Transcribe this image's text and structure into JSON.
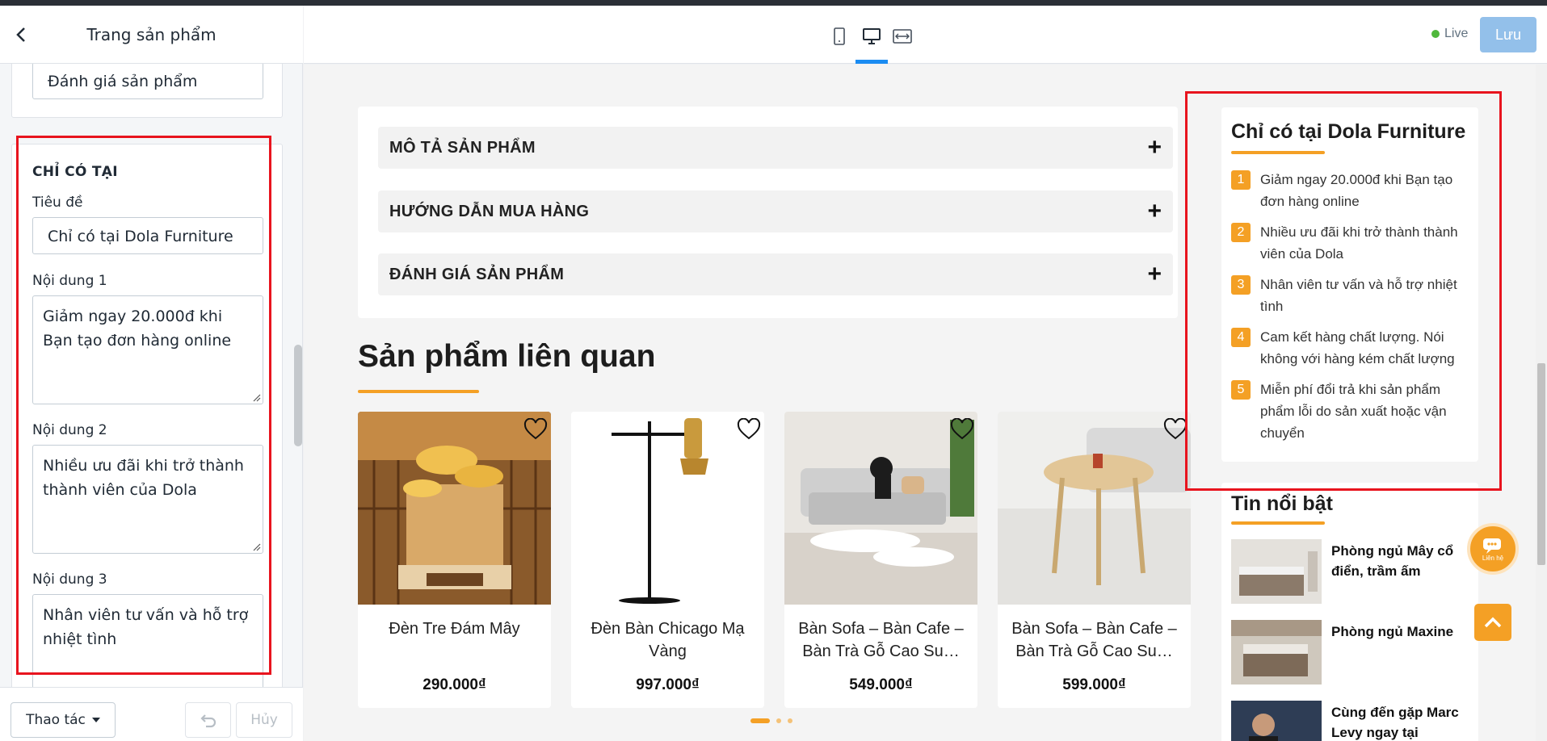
{
  "sidebar": {
    "title": "Trang sản phẩm",
    "review_field_value": "Đánh giá sản phẩm",
    "section_title": "CHỈ CÓ TẠI",
    "label_title": "Tiêu đề",
    "title_value": "Chỉ có tại Dola Furniture",
    "label_content1": "Nội dung 1",
    "content1_value": "Giảm ngay 20.000đ khi Bạn tạo đơn hàng online",
    "label_content2": "Nội dung 2",
    "content2_value": "Nhiều ưu đãi khi trở thành thành viên của Dola",
    "label_content3": "Nội dung 3",
    "content3_value": "Nhân viên tư vấn và hỗ trợ nhiệt tình",
    "footer": {
      "actions_label": "Thao tác",
      "cancel_label": "Hủy"
    }
  },
  "topbar": {
    "live_label": "Live",
    "save_label": "Lưu",
    "colors": {
      "accent": "#1b8cf2",
      "save_bg": "#93c0ea",
      "live_dot": "#50b83c"
    }
  },
  "preview": {
    "accordion": [
      {
        "label": "MÔ TẢ SẢN PHẨM"
      },
      {
        "label": "HƯỚNG DẪN MUA HÀNG"
      },
      {
        "label": "ĐÁNH GIÁ SẢN PHẨM"
      }
    ],
    "related_title": "Sản phẩm liên quan",
    "products": [
      {
        "name": "Đèn Tre Đám Mây",
        "price": "290.000₫"
      },
      {
        "name": "Đèn Bàn Chicago Mạ Vàng",
        "price": "997.000₫"
      },
      {
        "name": "Bàn Sofa – Bàn Cafe – Bàn Trà Gỗ Cao Su…",
        "price": "549.000₫"
      },
      {
        "name": "Bàn Sofa – Bàn Cafe – Bàn Trà Gỗ Cao Su…",
        "price": "599.000₫"
      }
    ],
    "only_at": {
      "title": "Chỉ có tại Dola Furniture",
      "items": [
        {
          "num": "1",
          "text": "Giảm ngay 20.000đ khi Bạn tạo đơn hàng online"
        },
        {
          "num": "2",
          "text": "Nhiều ưu đãi khi trở thành thành viên của Dola"
        },
        {
          "num": "3",
          "text": "Nhân viên tư vấn và hỗ trợ nhiệt tình"
        },
        {
          "num": "4",
          "text": "Cam kết hàng chất lượng. Nói không với hàng kém chất lượng"
        },
        {
          "num": "5",
          "text": "Miễn phí đổi trả khi sản phẩm phẩm lỗi do sản xuất hoặc vận chuyển"
        }
      ]
    },
    "news": {
      "title": "Tin nổi bật",
      "items": [
        {
          "title": "Phòng ngủ Mây cổ điển, trầm ấm"
        },
        {
          "title": "Phòng ngủ Maxine"
        },
        {
          "title": "Cùng đến gặp Marc Levy ngay tại"
        }
      ]
    },
    "contact_label": "Liên hệ",
    "colors": {
      "brand": "#f4a025"
    }
  }
}
